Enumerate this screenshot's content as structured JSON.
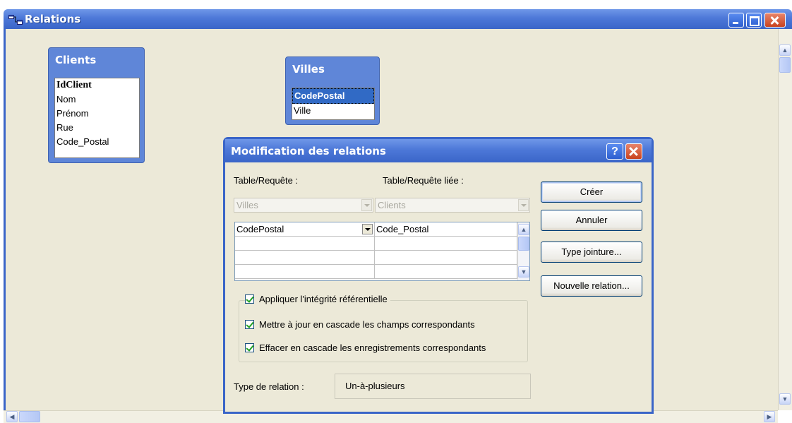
{
  "window": {
    "title": "Relations",
    "icon": "relationships-icon"
  },
  "tables": [
    {
      "name": "Clients",
      "fields": [
        "IdClient",
        "Nom",
        "Prénom",
        "Rue",
        "Code_Postal"
      ],
      "primary_key": "IdClient"
    },
    {
      "name": "Villes",
      "fields": [
        "CodePostal",
        "Ville"
      ],
      "selected": "CodePostal"
    }
  ],
  "dialog": {
    "title": "Modification des relations",
    "help_label": "?",
    "table_label": "Table/Requête :",
    "related_table_label": "Table/Requête liée :",
    "table_value": "Villes",
    "related_table_value": "Clients",
    "grid": [
      {
        "left": "CodePostal",
        "right": "Code_Postal"
      },
      {
        "left": "",
        "right": ""
      },
      {
        "left": "",
        "right": ""
      },
      {
        "left": "",
        "right": ""
      }
    ],
    "buttons": {
      "create": "Créer",
      "cancel": "Annuler",
      "join_type": "Type jointure...",
      "new_relation": "Nouvelle relation..."
    },
    "enforce_integrity": "Appliquer l'intégrité référentielle",
    "cascade_update": "Mettre à jour en cascade les champs correspondants",
    "cascade_delete": "Effacer en cascade les enregistrements correspondants",
    "relation_type_label": "Type de relation :",
    "relation_type_value": "Un-à-plusieurs"
  }
}
